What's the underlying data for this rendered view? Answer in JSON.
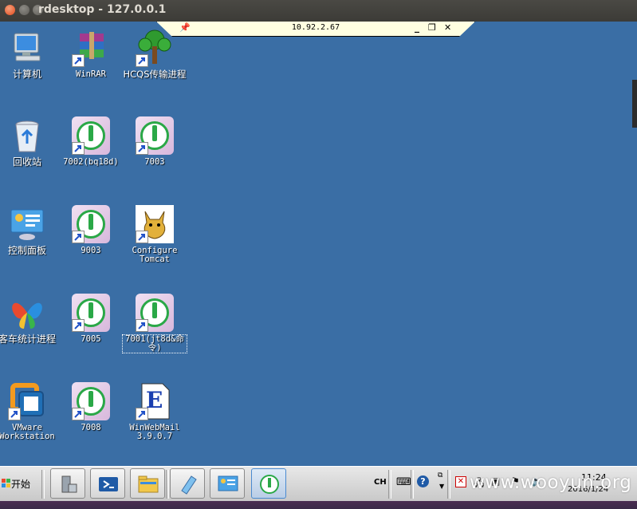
{
  "window": {
    "title": "rdesktop - 127.0.0.1"
  },
  "rdp_bar": {
    "host": "10.92.2.67",
    "minimize": "_",
    "restore": "❐",
    "close": "✕"
  },
  "icons": [
    {
      "label": "计算机",
      "icon": "computer-icon"
    },
    {
      "label": "WinRAR",
      "icon": "winrar-icon"
    },
    {
      "label": "HCQS传输进程",
      "icon": "tree-icon"
    },
    {
      "label": "回收站",
      "icon": "recycle-bin-icon"
    },
    {
      "label": "7002(bq18d)",
      "icon": "hnet-icon"
    },
    {
      "label": "7003",
      "icon": "hnet-icon"
    },
    {
      "label": "控制面板",
      "icon": "control-panel-icon"
    },
    {
      "label": "9003",
      "icon": "hnet-icon"
    },
    {
      "label": "Configure\nTomcat",
      "icon": "tomcat-icon"
    },
    {
      "label": "客车统计进程",
      "icon": "butterfly-icon"
    },
    {
      "label": "7005",
      "icon": "hnet-icon"
    },
    {
      "label": "7001(jt8d&命\n令)",
      "icon": "hnet-icon"
    },
    {
      "label": "VMware\nWorkstation",
      "icon": "vmware-icon"
    },
    {
      "label": "7008",
      "icon": "hnet-icon"
    },
    {
      "label": "WinWebMail\n3.9.0.7",
      "icon": "winwebmail-icon"
    }
  ],
  "taskbar": {
    "start_label": "开始",
    "lang": "CH",
    "time": "11:24",
    "date": "2016/1/24"
  },
  "watermark": "www.wooyun.org"
}
